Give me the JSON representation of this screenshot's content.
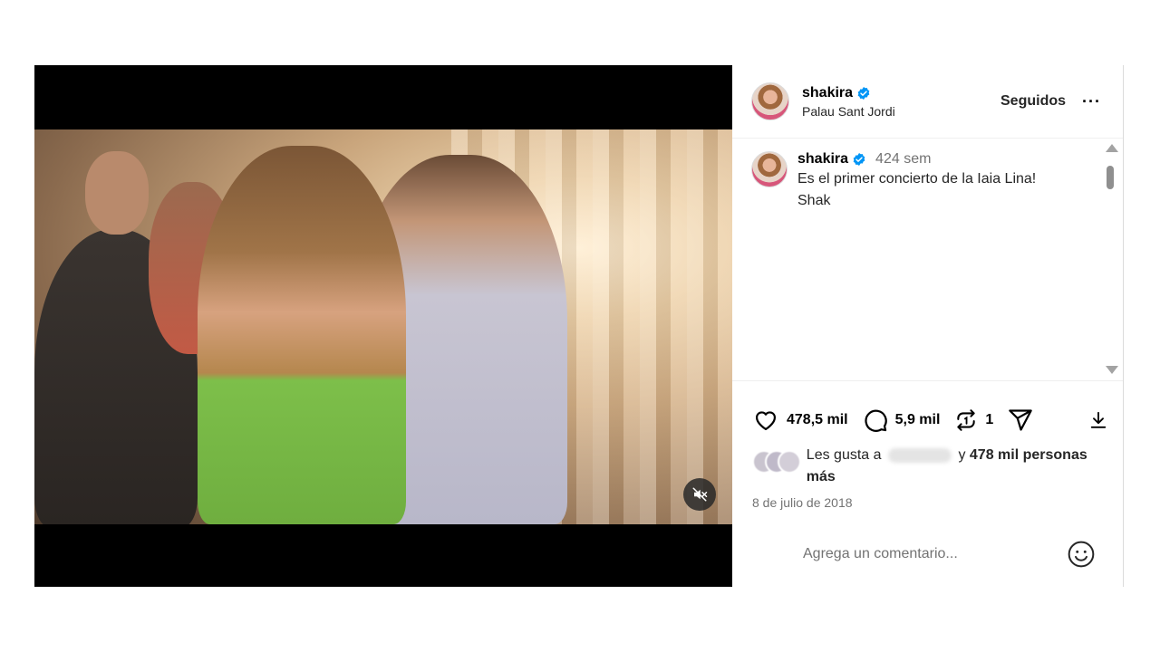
{
  "header": {
    "username": "shakira",
    "location": "Palau Sant Jordi",
    "follow_label": "Seguidos",
    "more_label": "···"
  },
  "caption": {
    "username": "shakira",
    "time": "424 sem",
    "line1": "Es el primer concierto de la Iaia Lina!",
    "line2": "Shak"
  },
  "actions": {
    "likes": "478,5 mil",
    "comments": "5,9 mil",
    "reposts": "1"
  },
  "likes_summary": {
    "prefix": "Les gusta a",
    "connector": "y",
    "rest": "478 mil personas más"
  },
  "date": "8 de julio de 2018",
  "comment_box": {
    "placeholder": "Agrega un comentario..."
  },
  "icons": {
    "verified": "verified-badge-icon",
    "like": "heart-icon",
    "comment": "comment-bubble-icon",
    "repost": "repost-icon",
    "share": "send-icon",
    "download": "download-icon",
    "mute": "muted-speaker-icon",
    "emoji": "smiley-icon"
  },
  "colors": {
    "verified": "#0095f6",
    "muted_text": "#737373"
  }
}
